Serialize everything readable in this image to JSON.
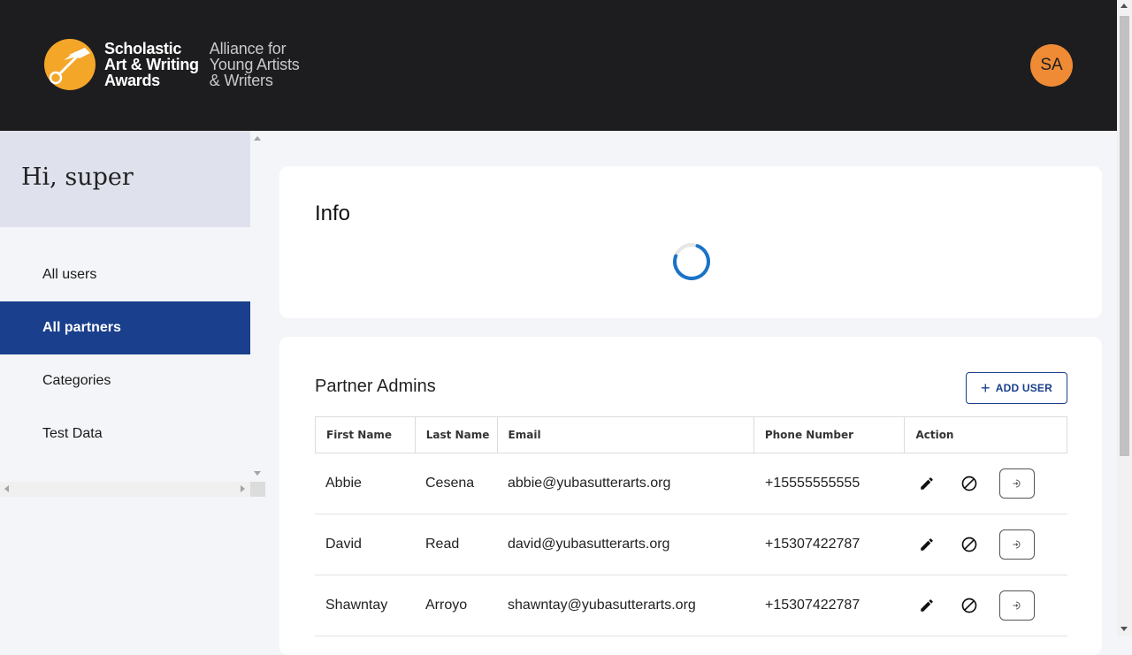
{
  "header": {
    "logo_title_lines": [
      "Scholastic",
      "Art & Writing",
      "Awards"
    ],
    "logo_sub_lines": [
      "Alliance for",
      "Young Artists",
      "& Writers"
    ],
    "avatar_initials": "SA",
    "logo_icon": "lamp-key-icon"
  },
  "sidebar": {
    "greeting": "Hi, super",
    "items": [
      {
        "label": "All users",
        "active": false
      },
      {
        "label": "All partners",
        "active": true
      },
      {
        "label": "Categories",
        "active": false
      },
      {
        "label": "Test Data",
        "active": false
      }
    ]
  },
  "info": {
    "title": "Info",
    "loading": true
  },
  "partners": {
    "title": "Partner Admins",
    "add_button_label": "ADD USER",
    "columns": [
      "First Name",
      "Last Name",
      "Email",
      "Phone Number",
      "Action"
    ],
    "rows": [
      {
        "first": "Abbie",
        "last": "Cesena",
        "email": "abbie@yubasutterarts.org",
        "phone": "+15555555555"
      },
      {
        "first": "David",
        "last": "Read",
        "email": "david@yubasutterarts.org",
        "phone": "+15307422787"
      },
      {
        "first": "Shawntay",
        "last": "Arroyo",
        "email": "shawntay@yubasutterarts.org",
        "phone": "+15307422787"
      }
    ],
    "row_actions": [
      "edit-icon",
      "block-icon",
      "login-as-icon"
    ]
  },
  "colors": {
    "header_bg": "#1d1d1f",
    "accent": "#1a3f8c",
    "avatar": "#ef8b35",
    "logo": "#f4a629"
  }
}
